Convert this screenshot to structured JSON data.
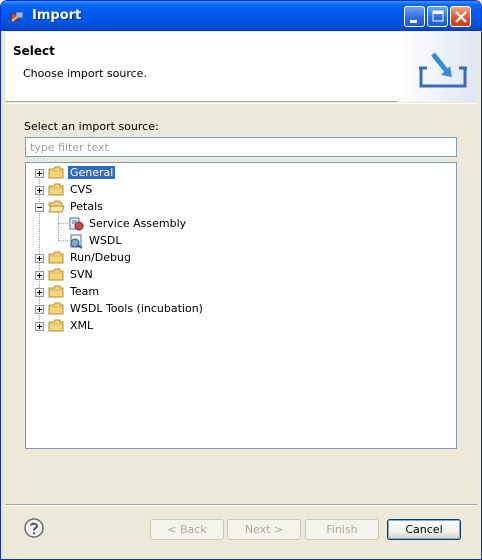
{
  "window": {
    "title": "Import"
  },
  "banner": {
    "title": "Select",
    "description": "Choose import source."
  },
  "filter": {
    "label": "Select an import source:",
    "placeholder": "type filter text",
    "value": ""
  },
  "tree": {
    "items": [
      {
        "label": "General",
        "icon": "folder-icon",
        "expander": "plus",
        "selected": true
      },
      {
        "label": "CVS",
        "icon": "folder-icon",
        "expander": "plus"
      },
      {
        "label": "Petals",
        "icon": "folder-open-icon",
        "expander": "minus",
        "children": [
          {
            "label": "Service Assembly",
            "icon": "service-assembly-icon"
          },
          {
            "label": "WSDL",
            "icon": "wsdl-icon"
          }
        ]
      },
      {
        "label": "Run/Debug",
        "icon": "folder-icon",
        "expander": "plus"
      },
      {
        "label": "SVN",
        "icon": "folder-icon",
        "expander": "plus"
      },
      {
        "label": "Team",
        "icon": "folder-icon",
        "expander": "plus"
      },
      {
        "label": "WSDL Tools (incubation)",
        "icon": "folder-icon",
        "expander": "plus"
      },
      {
        "label": "XML",
        "icon": "folder-icon",
        "expander": "plus"
      }
    ]
  },
  "buttons": {
    "back": "< Back",
    "next": "Next >",
    "finish": "Finish",
    "cancel": "Cancel"
  },
  "colors": {
    "titlebar": "#0055e5",
    "selection": "#316ac5",
    "dialog_bg": "#ece9d8"
  }
}
